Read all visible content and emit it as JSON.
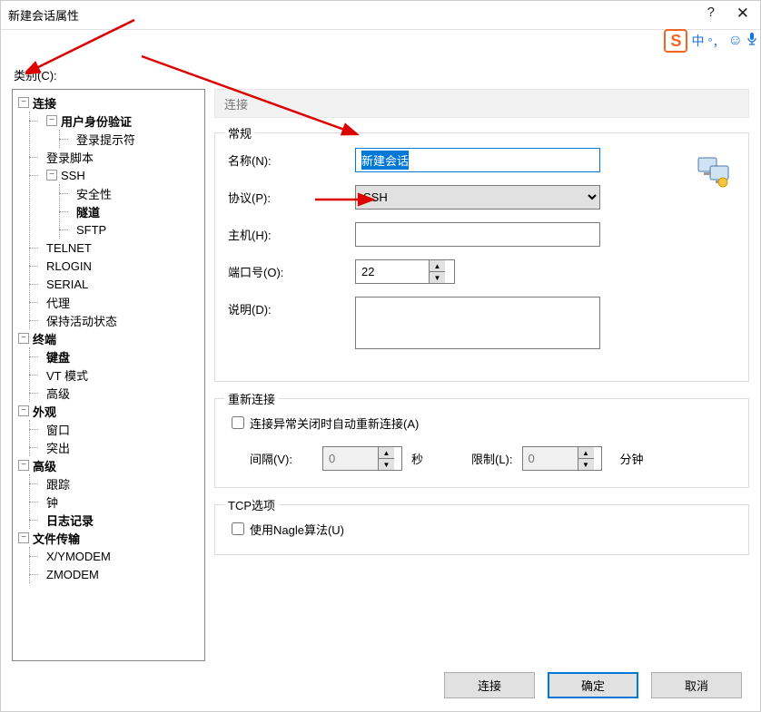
{
  "titlebar": {
    "title": "新建会话属性"
  },
  "category_label": "类别(C):",
  "tree": {
    "connection": {
      "label": "连接",
      "user_auth": {
        "label": "用户身份验证",
        "login_prompt": "登录提示符"
      },
      "login_script": "登录脚本",
      "ssh": {
        "label": "SSH",
        "security": "安全性",
        "tunnel": "隧道",
        "sftp": "SFTP"
      },
      "telnet": "TELNET",
      "rlogin": "RLOGIN",
      "serial": "SERIAL",
      "proxy": "代理",
      "keepalive": "保持活动状态"
    },
    "terminal": {
      "label": "终端",
      "keyboard": "键盘",
      "vt": "VT 模式",
      "advanced": "高级"
    },
    "appearance": {
      "label": "外观",
      "window": "窗口",
      "highlight": "突出"
    },
    "advanced": {
      "label": "高级",
      "trace": "跟踪",
      "bell": "钟",
      "log": "日志记录"
    },
    "transfer": {
      "label": "文件传输",
      "xymo": "X/YMODEM",
      "zmo": "ZMODEM"
    }
  },
  "right_title": "连接",
  "general": {
    "legend": "常规",
    "name_label": "名称(N):",
    "name_value": "新建会话",
    "protocol_label": "协议(P):",
    "protocol_value": "SSH",
    "host_label": "主机(H):",
    "host_value": "",
    "port_label": "端口号(O):",
    "port_value": "22",
    "desc_label": "说明(D):",
    "desc_value": ""
  },
  "reconnect": {
    "legend": "重新连接",
    "checkbox_label": "连接异常关闭时自动重新连接(A)",
    "interval_label": "间隔(V):",
    "interval_value": "0",
    "seconds": "秒",
    "limit_label": "限制(L):",
    "limit_value": "0",
    "minutes": "分钟"
  },
  "tcp": {
    "legend": "TCP选项",
    "nagle": "使用Nagle算法(U)"
  },
  "buttons": {
    "connect": "连接",
    "ok": "确定",
    "cancel": "取消"
  },
  "ime": {
    "cn": "中",
    "comma": "'，",
    "smile": "☺",
    "mic": "🎤"
  }
}
